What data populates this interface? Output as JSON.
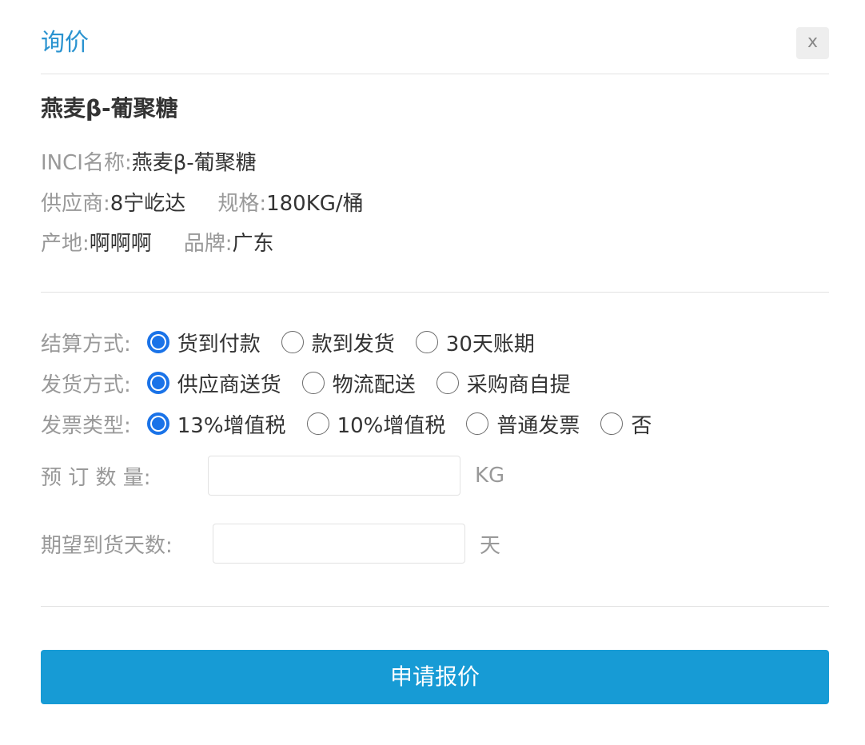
{
  "dialog": {
    "title": "询价",
    "close_label": "x"
  },
  "product": {
    "name": "燕麦β-葡聚糖",
    "inci_label": "INCI名称:",
    "inci_value": "燕麦β-葡聚糖",
    "supplier_label": "供应商:",
    "supplier_value": "8宁屹达",
    "spec_label": "规格:",
    "spec_value": "180KG/桶",
    "origin_label": "产地:",
    "origin_value": "啊啊啊",
    "brand_label": "品牌:",
    "brand_value": "广东"
  },
  "settlement": {
    "label": "结算方式:",
    "options": [
      "货到付款",
      "款到发货",
      "30天账期"
    ],
    "selected": "货到付款"
  },
  "delivery": {
    "label": "发货方式:",
    "options": [
      "供应商送货",
      "物流配送",
      "采购商自提"
    ],
    "selected": "供应商送货"
  },
  "invoice": {
    "label": "发票类型:",
    "options": [
      "13%增值税",
      "10%增值税",
      "普通发票",
      "否"
    ],
    "selected": "13%增值税"
  },
  "quantity": {
    "label": "预 订 数 量:",
    "value": "",
    "unit": "KG"
  },
  "arrival_days": {
    "label": "期望到货天数:",
    "value": "",
    "unit": "天"
  },
  "submit_label": "申请报价",
  "colors": {
    "accent": "#179bd5",
    "title": "#2a93d0",
    "radio_checked": "#1a73e8"
  }
}
